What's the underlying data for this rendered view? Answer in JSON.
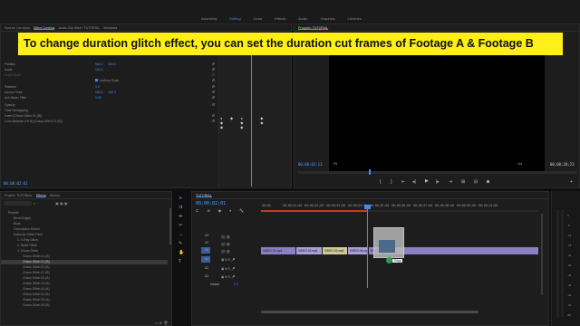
{
  "workspace_tabs": [
    "Assembly",
    "Editing",
    "Color",
    "Effects",
    "Audio",
    "Graphics",
    "Libraries"
  ],
  "active_workspace": "Editing",
  "banner": {
    "text": "To  change duration glitch effect, you can set the duration cut frames of Footage A & Footage B"
  },
  "effect_controls": {
    "tabs": [
      "Source: (no clips)",
      "Effect Controls",
      "Audio Clip Mixer: TUTORIAL",
      "Metadata"
    ],
    "active_tab": "Effect Controls",
    "properties": [
      {
        "label": "Position",
        "v1": "960.0",
        "v2": "540.0"
      },
      {
        "label": "Scale",
        "v1": "100.0",
        "v2": ""
      },
      {
        "label": "Scale Width",
        "v1": "",
        "v2": ""
      },
      {
        "label": "",
        "v1": "",
        "v2": "",
        "check": "Uniform Scale"
      },
      {
        "label": "Rotation",
        "v1": "0.0",
        "v2": ""
      },
      {
        "label": "Anchor Point",
        "v1": "960.0",
        "v2": "540.0"
      },
      {
        "label": "Anti-flicker Filter",
        "v1": "0.00",
        "v2": ""
      },
      {
        "label": "Opacity",
        "v1": "",
        "v2": ""
      },
      {
        "label": "Time Remapping",
        "v1": "",
        "v2": ""
      },
      {
        "label": "Invert (Chaos Glitch 01 (B))",
        "v1": "",
        "v2": ""
      },
      {
        "label": "Color Balance (HLS) (Chaos Glitch 01 (B))",
        "v1": "",
        "v2": ""
      }
    ],
    "timecode": "00;00;02;01"
  },
  "program_monitor": {
    "title": "Program: TUTORIAL",
    "current_timecode": "00;00;02;13",
    "fit": "Fit",
    "resolution": "1/4",
    "duration_timecode": "00;00;20;23"
  },
  "project_panel": {
    "tabs": [
      "Project: TUTORIAL",
      "Effects",
      "History"
    ],
    "active_tab": "Effects",
    "tree": [
      "Presets",
      "Bevel Edges",
      "Blurs",
      "Convolution Kernel",
      "Dadoche Glitch Pack",
      "1. X-Ray Glitch",
      "2. Noise Glitch",
      "3. Chaos Glitch",
      "Chaos Glitch 01 (A)",
      "Chaos Glitch 01 (B)",
      "Chaos Glitch 02 (A)",
      "Chaos Glitch 02 (B)",
      "Chaos Glitch 03 (A)",
      "Chaos Glitch 03 (B)",
      "Chaos Glitch 04 (A)",
      "Chaos Glitch 04 (B)",
      "Chaos Glitch 05 (A)",
      "Chaos Glitch 05 (B)"
    ],
    "selected_index": 9
  },
  "timeline": {
    "tab": "TUTORIAL",
    "timecode": "00;00;02;01",
    "ruler": [
      "00;00",
      "00;00;01;00",
      "00;00;02;00",
      "00;00;03;00",
      "00;00;04;00",
      "00;00;05;00",
      "00;00;06;00",
      "00;00;07;00",
      "00;00;08;00",
      "00;00;09;00",
      "00;00;10;00"
    ],
    "tracks": [
      "V3",
      "V2",
      "V1",
      "A1",
      "A2",
      "A3"
    ],
    "master": "Master",
    "master_value": "0.0",
    "clips": [
      "VIDEO 01.mp4",
      "VIDEO 02.mp4",
      "VIDEO 03.mp4",
      "VIDEO 04.mp4",
      "VIDEO 05.mp4"
    ],
    "copy_tooltip": "Copy"
  },
  "audio_meter": {
    "labels": [
      "0",
      "-6",
      "-12",
      "-18",
      "-24",
      "-30",
      "-36",
      "-42",
      "-48",
      "-54",
      "dB"
    ]
  },
  "colors": {
    "accent": "#3d8bff",
    "banner": "#ffef18",
    "clip_video": "#8a80c2",
    "clip_audio": "#2f9a52"
  }
}
